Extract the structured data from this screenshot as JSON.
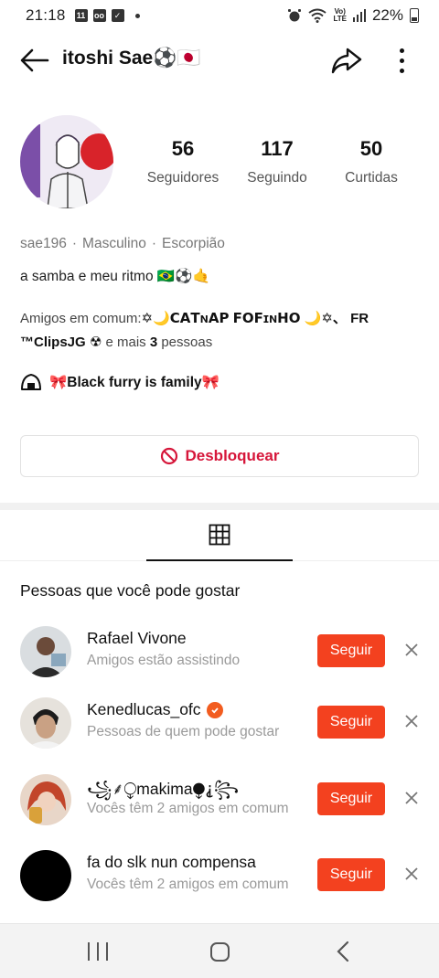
{
  "status_bar": {
    "time": "21:18",
    "battery": "22%"
  },
  "header": {
    "title": "itoshi Sae⚽🇯🇵"
  },
  "profile": {
    "stats": [
      {
        "value": "56",
        "label": "Seguidores"
      },
      {
        "value": "117",
        "label": "Seguindo"
      },
      {
        "value": "50",
        "label": "Curtidas"
      }
    ],
    "username": "sae196",
    "gender": "Masculino",
    "sign": "Escorpião",
    "bio": "a samba e meu ritmo 🇧🇷⚽🤙",
    "mutual_prefix": "Amigos em comum:",
    "mutual_name_1": "✡🌙ꓚꓮꓔɴꓮꓑ ꓝꓳꓝɪɴꓧꓳ 🌙✡、",
    "mutual_name_2": "FR ™ClipsJG ☢",
    "mutual_more": "e mais",
    "mutual_count": "3",
    "mutual_suffix": "pessoas",
    "community": "🎀Black furry is family🎀"
  },
  "actions": {
    "unblock_label": "Desbloquear"
  },
  "suggestions": {
    "title": "Pessoas que você pode gostar",
    "follow_label": "Seguir",
    "items": [
      {
        "name": "Rafael Vivone",
        "subtitle": "Amigos estão assistindo",
        "verified": false
      },
      {
        "name": "Kenedlucas_ofc",
        "subtitle": "Pessoas de quem pode gostar",
        "verified": true
      },
      {
        "name": "꧁⸙⧬makima⧭⸘꧂",
        "subtitle": "Vocês têm 2 amigos em comum",
        "verified": false
      },
      {
        "name": "fa do slk nun compensa",
        "subtitle": "Vocês têm 2 amigos em comum",
        "verified": false
      }
    ]
  },
  "colors": {
    "accent": "#f3411f",
    "danger": "#d6163a",
    "verified": "#f25c1f"
  },
  "icons": [
    "back-arrow-icon",
    "share-icon",
    "more-icon",
    "grid-icon",
    "block-icon",
    "close-icon",
    "onigiri-icon"
  ]
}
